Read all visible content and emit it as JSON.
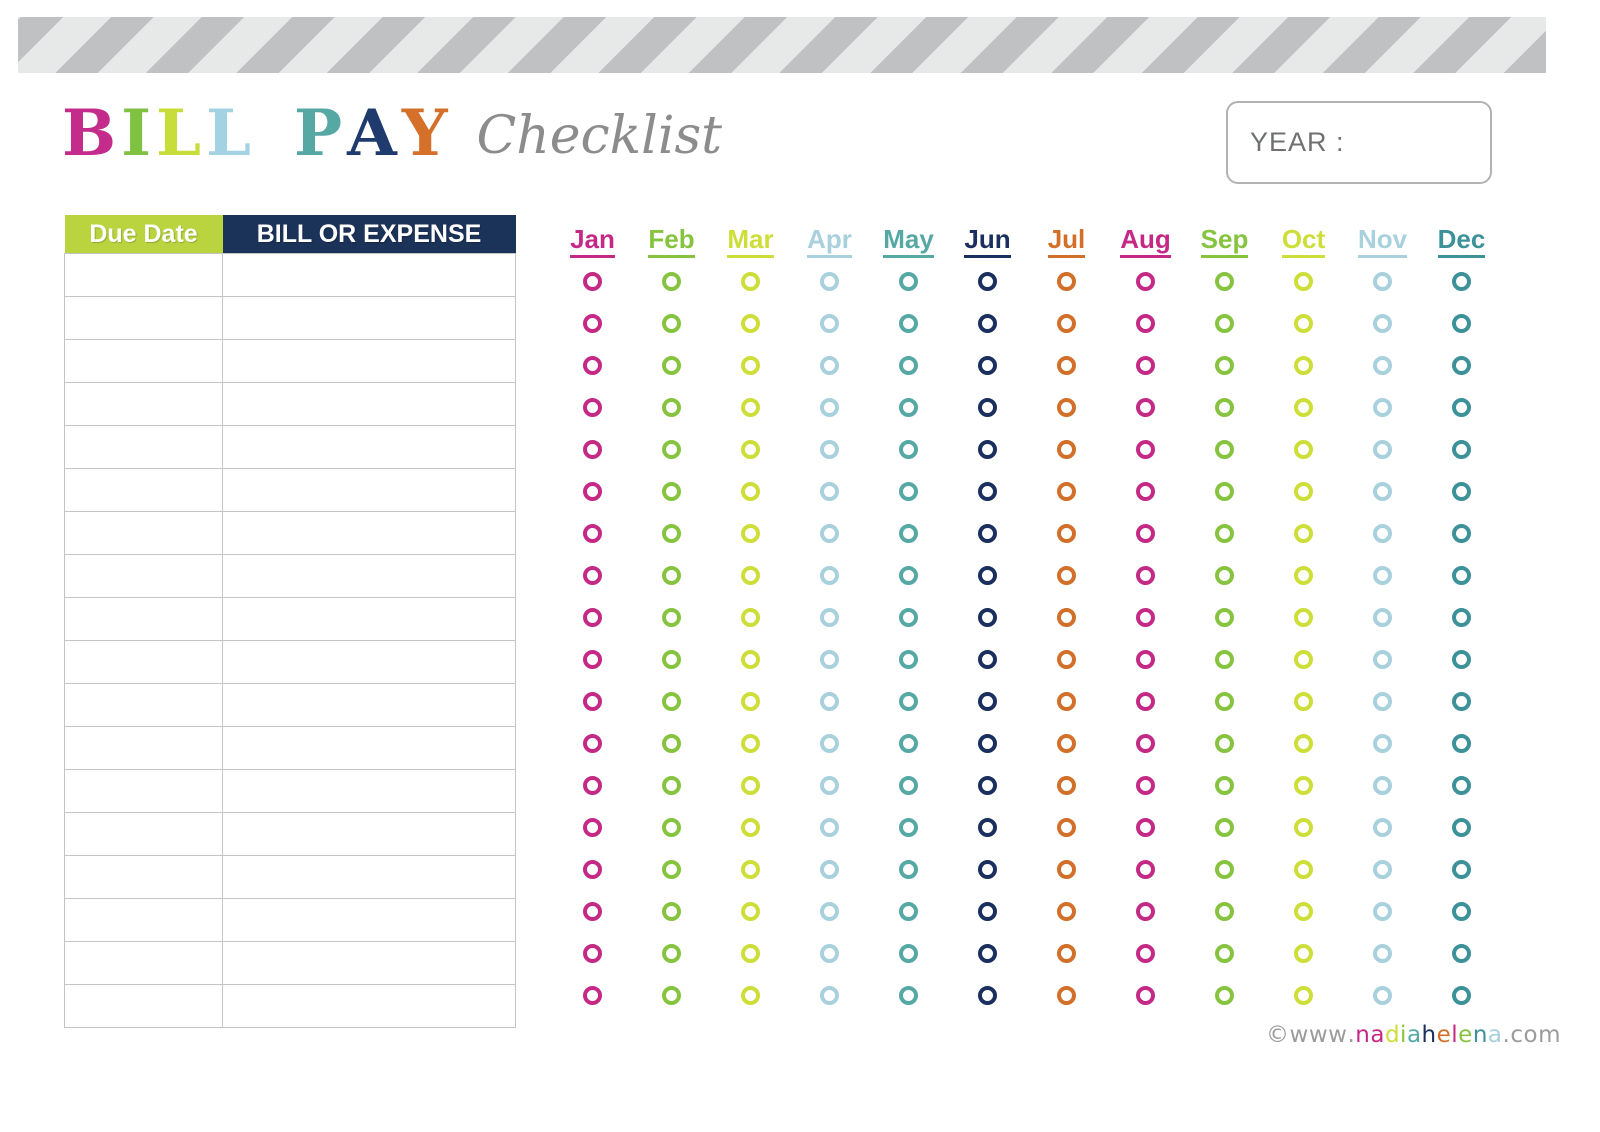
{
  "banner": {
    "name": "decorative-striped-banner"
  },
  "title": {
    "word1": "BILL",
    "word2": "PAY",
    "script": "Checklist",
    "word1_letters": [
      {
        "ch": "B",
        "color": "#c32c8a"
      },
      {
        "ch": "I",
        "color": "#7fc241"
      },
      {
        "ch": "L",
        "color": "#c8dd3a"
      },
      {
        "ch": "L",
        "color": "#a3d3e3"
      }
    ],
    "word2_letters": [
      {
        "ch": "P",
        "color": "#56a8a4"
      },
      {
        "ch": "A",
        "color": "#1f3b6e"
      },
      {
        "ch": "Y",
        "color": "#d4702a"
      }
    ],
    "script_color": "#8c8c8c"
  },
  "year": {
    "label": "YEAR :",
    "value": ""
  },
  "table": {
    "headers": [
      "Due Date",
      "BILL OR EXPENSE"
    ],
    "header_colors": [
      "#b9d43f",
      "#1c3359"
    ],
    "row_count": 18,
    "rows": [
      {
        "due_date": "",
        "bill": ""
      },
      {
        "due_date": "",
        "bill": ""
      },
      {
        "due_date": "",
        "bill": ""
      },
      {
        "due_date": "",
        "bill": ""
      },
      {
        "due_date": "",
        "bill": ""
      },
      {
        "due_date": "",
        "bill": ""
      },
      {
        "due_date": "",
        "bill": ""
      },
      {
        "due_date": "",
        "bill": ""
      },
      {
        "due_date": "",
        "bill": ""
      },
      {
        "due_date": "",
        "bill": ""
      },
      {
        "due_date": "",
        "bill": ""
      },
      {
        "due_date": "",
        "bill": ""
      },
      {
        "due_date": "",
        "bill": ""
      },
      {
        "due_date": "",
        "bill": ""
      },
      {
        "due_date": "",
        "bill": ""
      },
      {
        "due_date": "",
        "bill": ""
      },
      {
        "due_date": "",
        "bill": ""
      },
      {
        "due_date": "",
        "bill": ""
      }
    ]
  },
  "months": [
    {
      "label": "Jan",
      "color": "#c42a85"
    },
    {
      "label": "Feb",
      "color": "#86c440"
    },
    {
      "label": "Mar",
      "color": "#cede39"
    },
    {
      "label": "Apr",
      "color": "#a8d0dd"
    },
    {
      "label": "May",
      "color": "#56a8a4"
    },
    {
      "label": "Jun",
      "color": "#1b2f5e"
    },
    {
      "label": "Jul",
      "color": "#d2702a"
    },
    {
      "label": "Aug",
      "color": "#c42a85"
    },
    {
      "label": "Sep",
      "color": "#86c440"
    },
    {
      "label": "Oct",
      "color": "#cede39"
    },
    {
      "label": "Nov",
      "color": "#a8d0dd"
    },
    {
      "label": "Dec",
      "color": "#3d9199"
    }
  ],
  "checkbox_grid": {
    "rows": 18,
    "columns": 12,
    "checked": [],
    "state": "all-unchecked"
  },
  "footer": {
    "text": "© www.nadiahelena.com",
    "parts": [
      {
        "t": "© ",
        "color": "#9b9b9b"
      },
      {
        "t": "w",
        "color": "#9b9b9b"
      },
      {
        "t": "w",
        "color": "#9b9b9b"
      },
      {
        "t": "w",
        "color": "#9b9b9b"
      },
      {
        "t": ".",
        "color": "#9b9b9b"
      },
      {
        "t": "n",
        "color": "#c42a85"
      },
      {
        "t": "a",
        "color": "#c42a85"
      },
      {
        "t": "d",
        "color": "#cede39"
      },
      {
        "t": "i",
        "color": "#86c440"
      },
      {
        "t": "a",
        "color": "#56a8a4"
      },
      {
        "t": "h",
        "color": "#1b2f5e"
      },
      {
        "t": "e",
        "color": "#d2702a"
      },
      {
        "t": "l",
        "color": "#c42a85"
      },
      {
        "t": "e",
        "color": "#86c440"
      },
      {
        "t": "n",
        "color": "#3d9199"
      },
      {
        "t": "a",
        "color": "#a8d0dd"
      },
      {
        "t": ".",
        "color": "#9b9b9b"
      },
      {
        "t": "c",
        "color": "#9b9b9b"
      },
      {
        "t": "o",
        "color": "#9b9b9b"
      },
      {
        "t": "m",
        "color": "#9b9b9b"
      }
    ]
  }
}
